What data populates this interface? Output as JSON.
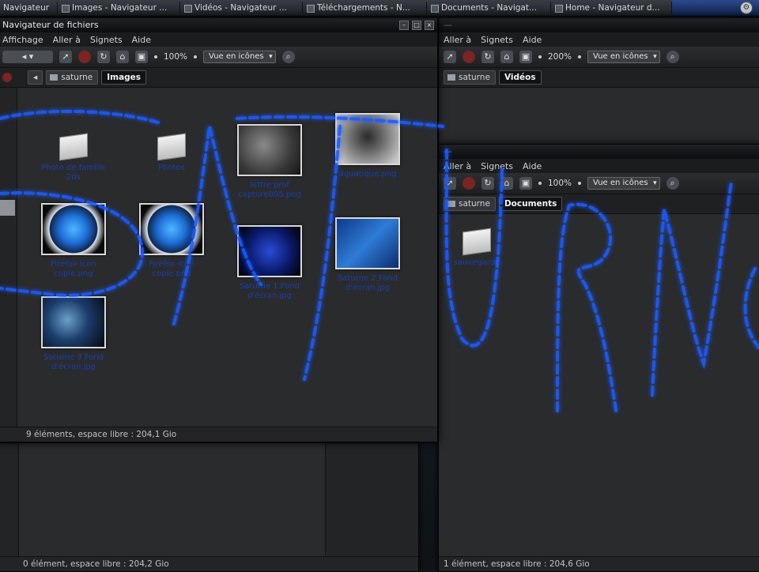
{
  "taskbar": {
    "tasks": [
      "Navigateur",
      "Images - Navigateur ...",
      "Vidéos - Navigateur ...",
      "Téléchargements - N...",
      "Documents - Navigat...",
      "Home - Navigateur d..."
    ]
  },
  "window_images": {
    "title": "Navigateur de fichiers",
    "menu": [
      "Affichage",
      "Aller à",
      "Signets",
      "Aide"
    ],
    "zoom": "100%",
    "view_mode": "Vue en icônes",
    "crumbs": [
      "saturne",
      "Images"
    ],
    "items": [
      {
        "label": "Photo de famille 2ds",
        "kind": "folder"
      },
      {
        "label": "Photos",
        "kind": "folder"
      },
      {
        "label": "lettre prof capture005.png",
        "kind": "thumb",
        "style": "t-gray"
      },
      {
        "label": "aquatique.png",
        "kind": "thumb",
        "style": "t-gray2"
      },
      {
        "label": "Firefox-icon copie.png",
        "kind": "thumb",
        "style": "t-ff"
      },
      {
        "label": "Firefox-icon copie.png",
        "kind": "thumb",
        "style": "t-ff"
      },
      {
        "label": "Saturne 1 Fond d'écran.jpg",
        "kind": "thumb",
        "style": "t-blue1"
      },
      {
        "label": "Saturne 2 Fond d'écran.jpg",
        "kind": "thumb",
        "style": "t-blue2"
      },
      {
        "label": "Saturne 3 Fond d'écran.jpg",
        "kind": "thumb",
        "style": "t-blue3"
      }
    ],
    "status": "9 éléments, espace libre : 204,1 Gio"
  },
  "window_videos": {
    "menu": [
      "Aller à",
      "Signets",
      "Aide"
    ],
    "zoom": "200%",
    "view_mode": "Vue en icônes",
    "crumbs": [
      "saturne",
      "Vidéos"
    ]
  },
  "window_documents": {
    "menu": [
      "Aller à",
      "Signets",
      "Aide"
    ],
    "zoom": "100%",
    "view_mode": "Vue en icônes",
    "crumbs": [
      "saturne",
      "Documents"
    ],
    "items": [
      {
        "label": "sauvegarde",
        "kind": "folder"
      }
    ],
    "status": "1 élément, espace libre : 204,6 Gio"
  },
  "window_bottom_left": {
    "status": "0 élément, espace libre : 204,2 Gio"
  },
  "colors": {
    "accent_blue": "#1f5cff",
    "label_blue": "#1a3fae"
  }
}
